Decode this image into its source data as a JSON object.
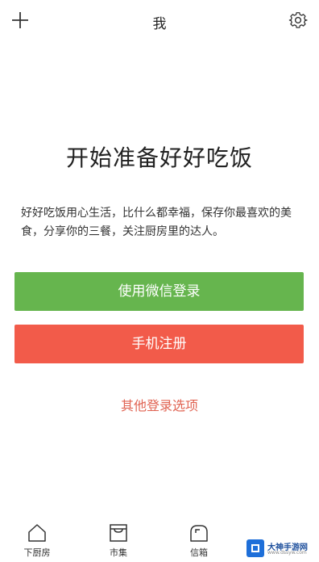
{
  "header": {
    "title": "我",
    "left_icon": "plus-icon",
    "right_icon": "gear-icon"
  },
  "main": {
    "headline": "开始准备好好吃饭",
    "intro": "好好吃饭用心生活，比什么都幸福，保存你最喜欢的美食，分享你的三餐，关注厨房里的达人。",
    "wechat_login_label": "使用微信登录",
    "phone_register_label": "手机注册",
    "other_login_label": "其他登录选项"
  },
  "tabbar": {
    "items": [
      {
        "label": "下厨房",
        "icon": "house-icon"
      },
      {
        "label": "市集",
        "icon": "store-icon"
      },
      {
        "label": "信箱",
        "icon": "mailbox-icon"
      }
    ]
  },
  "watermark": {
    "text": "大神手游网",
    "sub": "www.dssyw.com"
  },
  "colors": {
    "wechat_button": "#66b54e",
    "phone_button": "#f25b4a",
    "other_login_text": "#e06352"
  }
}
